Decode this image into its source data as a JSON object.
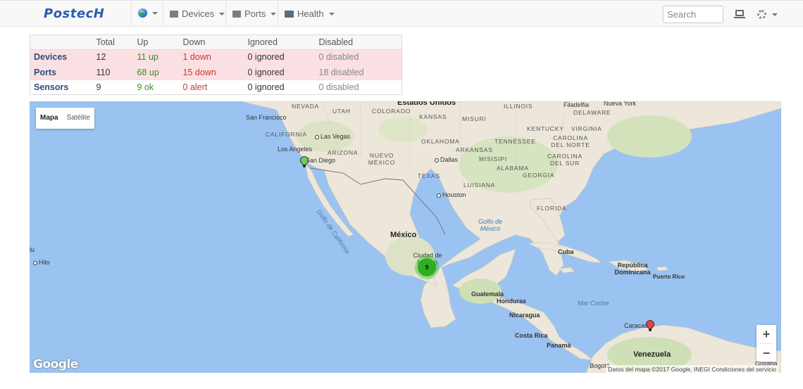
{
  "nav": {
    "brand": "PostecH",
    "devices_label": "Devices",
    "ports_label": "Ports",
    "health_label": "Health",
    "search_placeholder": "Search"
  },
  "summary": {
    "headers": [
      "",
      "Total",
      "Up",
      "Down",
      "Ignored",
      "Disabled"
    ],
    "rows": [
      {
        "label": "Devices",
        "total": "12",
        "up": "11 up",
        "down": "1 down",
        "ignored": "0 ignored",
        "disabled": "0 disabled"
      },
      {
        "label": "Ports",
        "total": "110",
        "up": "68 up",
        "down": "15 down",
        "ignored": "0 ignored",
        "disabled": "18 disabled"
      },
      {
        "label": "Sensors",
        "total": "9",
        "up": "9 ok",
        "down": "0 alert",
        "ignored": "0 ignored",
        "disabled": "0 disabled"
      }
    ]
  },
  "map": {
    "type_map": "Mapa",
    "type_satellite": "Satélite",
    "zoom_in": "+",
    "zoom_out": "−",
    "logo": "Google",
    "attribution": "Datos del mapa ©2017 Google, INEGI   Condiciones del servicio",
    "cluster_count": "9",
    "labels": {
      "estados_unidos": "Estados Unidos",
      "nevada": "NEVADA",
      "utah": "UTAH",
      "colorado": "COLORADO",
      "kansas": "KANSAS",
      "misuri": "MISURI",
      "illinois": "ILLINOIS",
      "filadelfia": "Filadelfia",
      "nueva_york": "Nueva York",
      "delaware": "DELAWARE",
      "san_francisco": "San Francisco",
      "california": "CALIFORNIA",
      "las_vegas": "Las Vegas",
      "kentucky": "KENTUCKY",
      "virginia": "VIRGINIA",
      "carolina_norte": "CAROLINA DEL NORTE",
      "tennessee": "TENNESSEE",
      "oklahoma": "OKLAHOMA",
      "arkansas": "ARKANSAS",
      "los_angeles": "Los Angeles",
      "arizona": "ARIZONA",
      "nuevo_mexico": "NUEVO MÉXICO",
      "san_diego": "San Diego",
      "dallas": "Dallas",
      "misisipi": "MISISIPI",
      "alabama": "ALABAMA",
      "georgia": "GEORGIA",
      "carolina_sur": "CAROLINA DEL SUR",
      "texas": "TEXAS",
      "luisiana": "LUISIANA",
      "houston": "Houston",
      "florida": "FLORIDA",
      "golfo_california": "Golfo de California",
      "golfo_mexico": "Golfo de México",
      "mexico": "México",
      "ciudad_mexico": "Ciudad de México",
      "cuba": "Cuba",
      "republica_dominicana": "República Dominicana",
      "puerto_rico": "Puerto Rico",
      "guatemala": "Guatemala",
      "honduras": "Honduras",
      "mar_caribe": "Mar Caribe",
      "nicaragua": "Nicaragua",
      "caracas": "Caracas",
      "costa_rica": "Costa Rica",
      "panama": "Panamá",
      "venezuela": "Venezuela",
      "bogota": "Bogotá",
      "guayana": "Guyana",
      "hilo": "Hilo",
      "lu": "lu"
    }
  },
  "colors": {
    "ocean": "#9bc3f1",
    "land": "#e8e4d8",
    "cluster": "#2eae22",
    "pin_green": "#6fce5a",
    "pin_red": "#e8414b",
    "row_alert": "#fbe0e3"
  }
}
